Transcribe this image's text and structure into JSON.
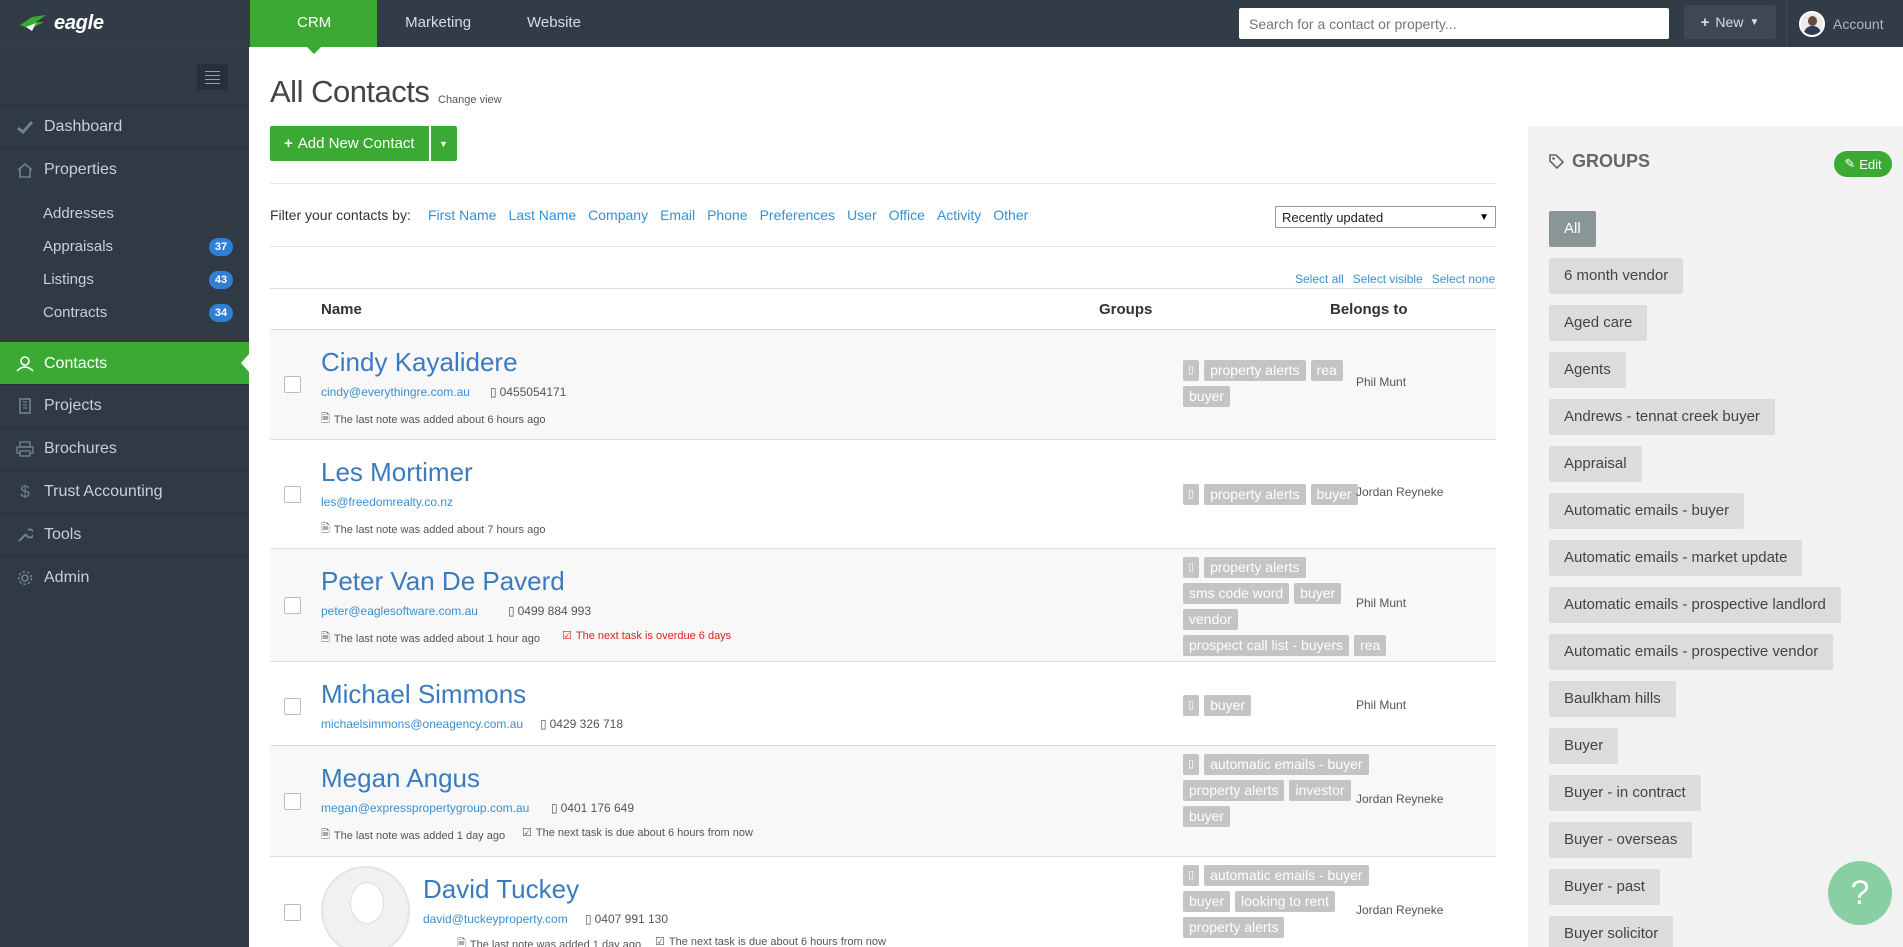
{
  "brand": {
    "name": "eagle"
  },
  "topnav": {
    "tabs": [
      {
        "label": "CRM"
      },
      {
        "label": "Marketing"
      },
      {
        "label": "Website"
      }
    ]
  },
  "header": {
    "search_placeholder": "Search for a contact or property...",
    "new_label": "New",
    "account_label": "Account"
  },
  "sidebar": {
    "dashboard": "Dashboard",
    "properties": "Properties",
    "addresses": "Addresses",
    "appraisals": "Appraisals",
    "appraisals_count": "37",
    "listings": "Listings",
    "listings_count": "43",
    "contracts": "Contracts",
    "contracts_count": "34",
    "contacts": "Contacts",
    "projects": "Projects",
    "brochures": "Brochures",
    "trust": "Trust Accounting",
    "tools": "Tools",
    "admin": "Admin"
  },
  "page": {
    "title": "All Contacts",
    "change_view": "Change view",
    "add_button": "Add New Contact",
    "filter_label": "Filter your contacts by:",
    "filters": [
      "First Name",
      "Last Name",
      "Company",
      "Email",
      "Phone",
      "Preferences",
      "User",
      "Office",
      "Activity",
      "Other"
    ],
    "sort_value": "Recently updated",
    "select_all": "Select all",
    "select_visible": "Select visible",
    "select_none": "Select none"
  },
  "table": {
    "headers": {
      "name": "Name",
      "groups": "Groups",
      "belongs": "Belongs to"
    },
    "rows": [
      {
        "name": "Cindy Kayalidere",
        "email": "cindy@everythingre.com.au",
        "phone": "0455054171",
        "note": "The last note was added about 6 hours ago",
        "task": "",
        "tags": [
          "▯",
          "property alerts",
          "rea",
          "buyer"
        ],
        "belongs": "Phil Munt"
      },
      {
        "name": "Les Mortimer",
        "email": "les@freedomrealty.co.nz",
        "phone": "",
        "note": "The last note was added about 7 hours ago",
        "task": "",
        "tags": [
          "▯",
          "property alerts",
          "buyer"
        ],
        "belongs": "Jordan Reyneke"
      },
      {
        "name": "Peter Van De Paverd",
        "email": "peter@eaglesoftware.com.au",
        "phone": "0499 884 993",
        "note": "The last note was added about 1 hour ago",
        "task": "The next task is overdue 6 days",
        "tags": [
          "▯",
          "property alerts",
          "sms code word",
          "buyer",
          "vendor",
          "prospect call list - buyers",
          "rea"
        ],
        "belongs": "Phil Munt"
      },
      {
        "name": "Michael Simmons",
        "email": "michaelsimmons@oneagency.com.au",
        "phone": "0429 326 718",
        "note": "",
        "task": "",
        "tags": [
          "▯",
          "buyer"
        ],
        "belongs": "Phil Munt"
      },
      {
        "name": "Megan Angus",
        "email": "megan@expresspropertygroup.com.au",
        "phone": "0401 176 649",
        "note": "The last note was added 1 day ago",
        "task": "The next task is due about 6 hours from now",
        "tags": [
          "▯",
          "automatic emails - buyer",
          "property alerts",
          "investor",
          "buyer"
        ],
        "belongs": "Jordan Reyneke"
      },
      {
        "name": "David Tuckey",
        "email": "david@tuckeyproperty.com",
        "phone": "0407 991 130",
        "note": "The last note was added 1 day ago",
        "task": "The next task is due about 6 hours from now",
        "tags": [
          "▯",
          "automatic emails - buyer",
          "buyer",
          "looking to rent",
          "property alerts"
        ],
        "belongs": "Jordan Reyneke"
      }
    ]
  },
  "groups": {
    "title": "GROUPS",
    "edit": "Edit",
    "items": [
      "All",
      "6 month vendor",
      "Aged care",
      "Agents",
      "Andrews - tennat creek buyer",
      "Appraisal",
      "Automatic emails - buyer",
      "Automatic emails - market update",
      "Automatic emails - prospective landlord",
      "Automatic emails - prospective vendor",
      "Baulkham hills",
      "Buyer",
      "Buyer - in contract",
      "Buyer - overseas",
      "Buyer - past",
      "Buyer solicitor"
    ]
  },
  "help": {
    "label": "?"
  },
  "colors": {
    "accent": "#3aaa35",
    "sidebar": "#2f3a45",
    "link": "#3a8fd0",
    "badge": "#2f7fd6",
    "overdue": "#e02020"
  }
}
